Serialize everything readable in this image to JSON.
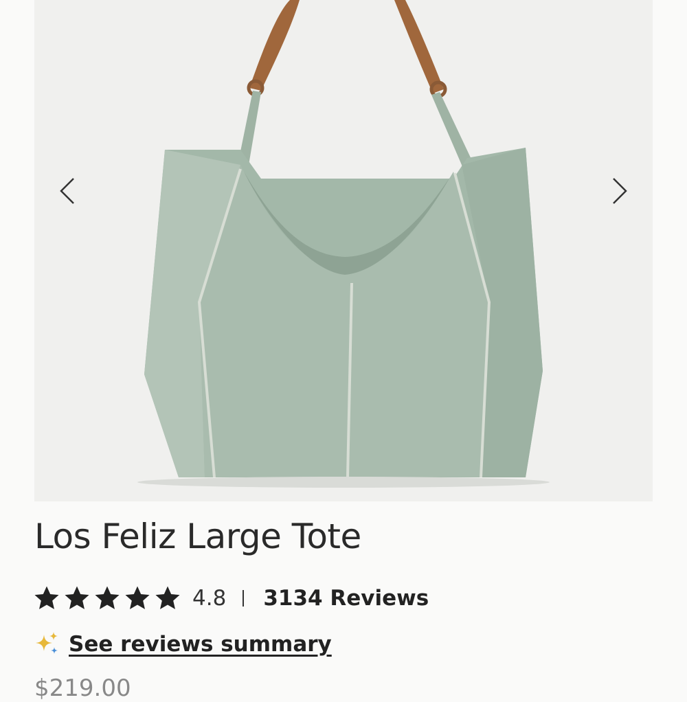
{
  "gallery": {
    "image_alt": "Los Feliz Large Tote sage green leather bag",
    "prev_icon": "chevron-left-icon",
    "next_icon": "chevron-right-icon"
  },
  "product": {
    "title": "Los Feliz Large Tote",
    "rating": {
      "stars": 5,
      "value": "4.8",
      "count_label": "3134 Reviews"
    },
    "ai_summary": {
      "icon": "sparkle-icon",
      "label": "See reviews summary"
    },
    "price": "$219.00"
  },
  "colors": {
    "bag": "#a9bcae",
    "strap": "#a0673c",
    "text": "#222222",
    "sparkle": "#e7b83a"
  }
}
